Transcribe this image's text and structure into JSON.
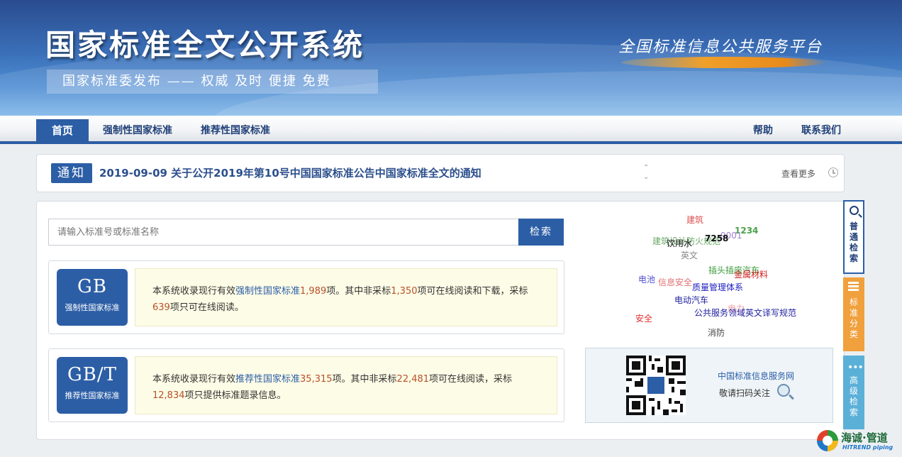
{
  "banner": {
    "title": "国家标准全文公开系统",
    "subtitle": "国家标准委发布 —— 权威 及时 便捷 免费",
    "slogan": "全国标准信息公共服务平台"
  },
  "nav": {
    "home": "首页",
    "mandatory": "强制性国家标准",
    "recommended": "推荐性国家标准",
    "help": "帮助",
    "contact": "联系我们"
  },
  "notice": {
    "badge": "通知",
    "text": "2019-09-09  关于公开2019年第10号中国国家标准公告中国家标准全文的通知",
    "more": "查看更多"
  },
  "search": {
    "placeholder": "请输入标准号或标准名称",
    "button": "检索"
  },
  "standards": {
    "gb": {
      "code": "GB",
      "name": "强制性国家标准",
      "desc_prefix": "本系统收录现行有效",
      "type_link": "强制性国家标准",
      "total": "1,989",
      "desc_mid1": "项。其中非采标",
      "non_adopted": "1,350",
      "desc_mid2": "项可在线阅读和下载，采标",
      "adopted": "639",
      "desc_suffix": "项只可在线阅读。"
    },
    "gbt": {
      "code": "GB/T",
      "name": "推荐性国家标准",
      "desc_prefix": "本系统收录现行有效",
      "type_link": "推荐性国家标准",
      "total": "35,315",
      "desc_mid1": "项。其中非采标",
      "non_adopted": "22,481",
      "desc_mid2": "项可在线阅读，采标",
      "adopted": "12,834",
      "desc_suffix": "项只提供标准题录信息。"
    }
  },
  "tag_cloud": [
    {
      "text": "建筑",
      "color": "#e05050"
    },
    {
      "text": "1234",
      "color": "#4aa04a"
    },
    {
      "text": "建筑设计防火规范",
      "color": "#6aaa6a"
    },
    {
      "text": "9001",
      "color": "#a080d0"
    },
    {
      "text": "7258",
      "color": "#111111"
    },
    {
      "text": "饮用水",
      "color": "#111111"
    },
    {
      "text": "英文",
      "color": "#888888"
    },
    {
      "text": "插头插座汽车",
      "color": "#3a9a3a"
    },
    {
      "text": "电池",
      "color": "#5050d0"
    },
    {
      "text": "信息安全",
      "color": "#e07070"
    },
    {
      "text": "金属材料",
      "color": "#d02020"
    },
    {
      "text": "质量管理体系",
      "color": "#2020c0"
    },
    {
      "text": "电动汽车",
      "color": "#2020a0"
    },
    {
      "text": "电力",
      "color": "#f0a0a0"
    },
    {
      "text": "公共服务领域英文译写规范",
      "color": "#2020a0"
    },
    {
      "text": "安全",
      "color": "#e03030"
    },
    {
      "text": "消防",
      "color": "#444444"
    }
  ],
  "qr": {
    "title": "中国标准信息服务网",
    "subtitle": "敬请扫码关注"
  },
  "side_tabs": {
    "search": "普通检索",
    "classify": "标准分类",
    "advanced": "高级检索"
  },
  "brand": {
    "cn": "海诚·管道",
    "en": "HITREND piping"
  }
}
